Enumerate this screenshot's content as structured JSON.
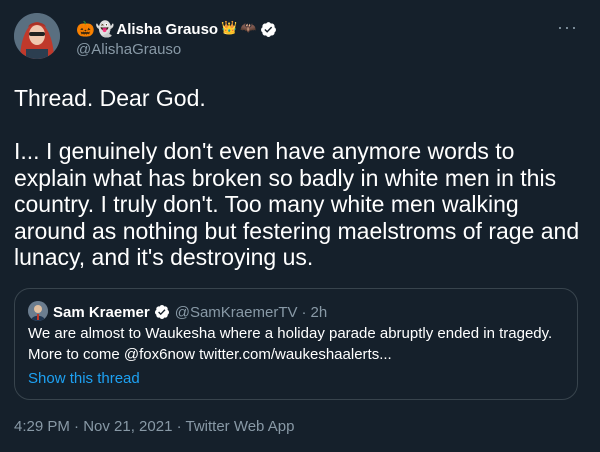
{
  "author": {
    "emoji_prefix": [
      "🎃",
      "👻"
    ],
    "display_name": "Alisha Grauso",
    "emoji_suffix": [
      "👑",
      "🦇"
    ],
    "handle": "@AlishaGrauso",
    "verified": true
  },
  "more_icon": "···",
  "tweet": {
    "paragraphs": [
      "Thread. Dear God.",
      "I... I genuinely don't even have anymore words to explain what has broken so badly in white men in this country. I truly don't. Too many white men walking around as nothing but festering maelstroms of rage and lunacy, and it's destroying us."
    ]
  },
  "quote": {
    "name": "Sam Kraemer",
    "verified": true,
    "handle": "@SamKraemerTV",
    "separator": "·",
    "time": "2h",
    "lines": [
      "We are almost to Waukesha where a holiday parade abruptly ended in tragedy.",
      "More to come @fox6now twitter.com/waukeshaalerts..."
    ],
    "show_thread": "Show this thread"
  },
  "meta": {
    "timestamp": "4:29 PM · Nov 21, 2021 · Twitter Web App"
  },
  "colors": {
    "background": "#15202b",
    "text": "#ffffff",
    "secondary": "#8899a6",
    "link": "#1da1f2",
    "border": "#38444d",
    "verified": "#ffffff"
  }
}
